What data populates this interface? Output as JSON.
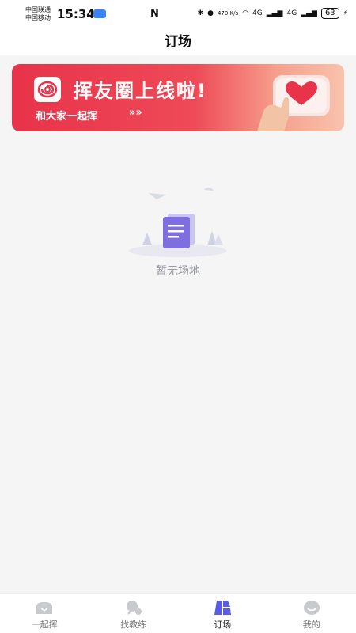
{
  "status_bar": {
    "carrier1": "中国联通",
    "carrier2": "中国移动",
    "time": "15:34",
    "nfc": "N",
    "net_speed": "470 K/s",
    "signal1": "4G",
    "signal2": "4G",
    "battery": "63"
  },
  "header": {
    "title": "订场"
  },
  "banner": {
    "title": "挥友圈上线啦!",
    "subtitle": "和大家一起挥",
    "arrows": "»»"
  },
  "empty_state": {
    "text": "暂无场地"
  },
  "tabbar": {
    "active_index": 2,
    "tabs": [
      {
        "label": "一起挥",
        "icon": "home-icon"
      },
      {
        "label": "找教练",
        "icon": "coach-icon"
      },
      {
        "label": "订场",
        "icon": "court-icon"
      },
      {
        "label": "我的",
        "icon": "profile-icon"
      }
    ]
  }
}
